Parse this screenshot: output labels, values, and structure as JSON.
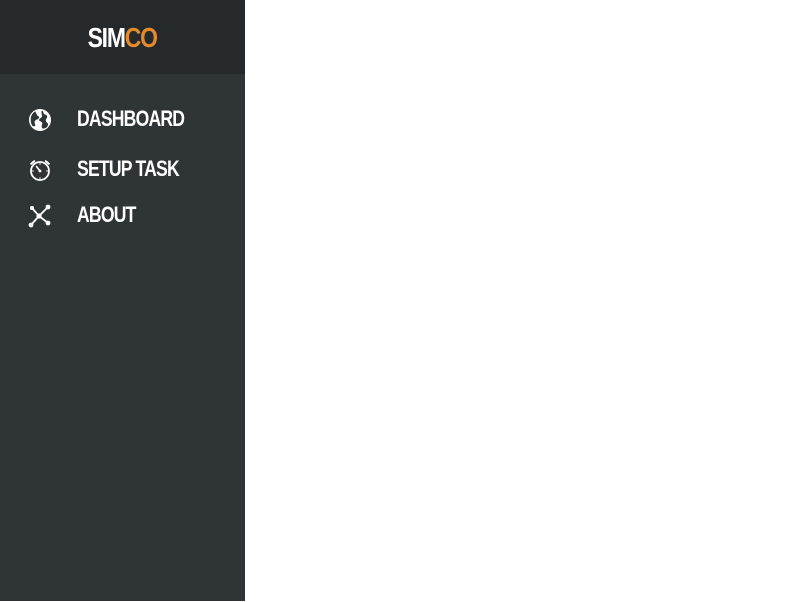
{
  "brand": {
    "name_primary": "SIM",
    "name_accent": "CO",
    "accent_color": "#e48a2a"
  },
  "sidebar": {
    "background": "#2f3437",
    "header_background": "#25292b",
    "items": [
      {
        "label": "DASHBOARD",
        "icon": "globe-icon"
      },
      {
        "label": "SETUP TASK",
        "icon": "stopwatch-icon"
      },
      {
        "label": "ABOUT",
        "icon": "network-icon"
      }
    ]
  }
}
